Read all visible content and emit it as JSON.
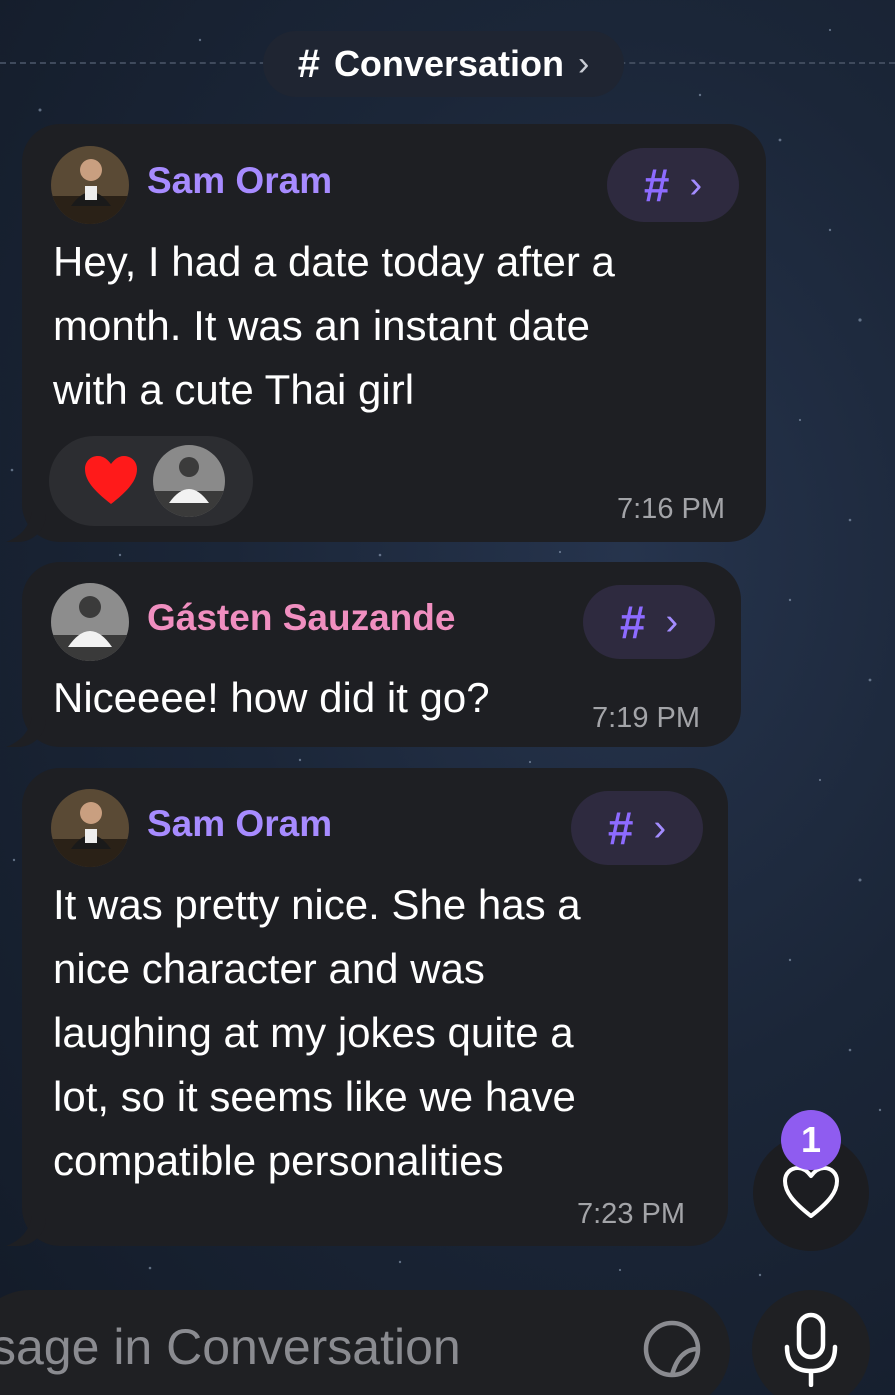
{
  "topic": {
    "label": "Conversation",
    "hash": "#",
    "chevron": "›"
  },
  "messages": [
    {
      "sender": "Sam Oram",
      "sender_color": "#a78bff",
      "text_lines": [
        "Hey, I had a date today after a",
        "month. It was an instant date",
        "with a cute Thai girl"
      ],
      "time": "7:16 PM",
      "reaction": {
        "emoji": "heart",
        "color": "#ff1a1a"
      }
    },
    {
      "sender": "Gásten Sauzande",
      "sender_color": "#f08fc0",
      "text_lines": [
        "Niceeee! how did it go?"
      ],
      "time": "7:19 PM"
    },
    {
      "sender": "Sam Oram",
      "sender_color": "#a78bff",
      "text_lines": [
        "It was pretty nice. She has a",
        "nice character and was",
        "laughing at my jokes quite a",
        "lot, so it seems like we have",
        "compatible personalities"
      ],
      "time": "7:23 PM"
    }
  ],
  "thread_button": {
    "hash": "#",
    "chevron": "›"
  },
  "reactions_button": {
    "badge": "1",
    "icon": "heart-outline-icon"
  },
  "composer": {
    "placeholder": "ssage in Conversation",
    "sticker_icon": "sticker-icon",
    "mic_icon": "microphone-icon"
  },
  "colors": {
    "accent": "#8f5cf0",
    "bubble": "#1e1f23"
  }
}
